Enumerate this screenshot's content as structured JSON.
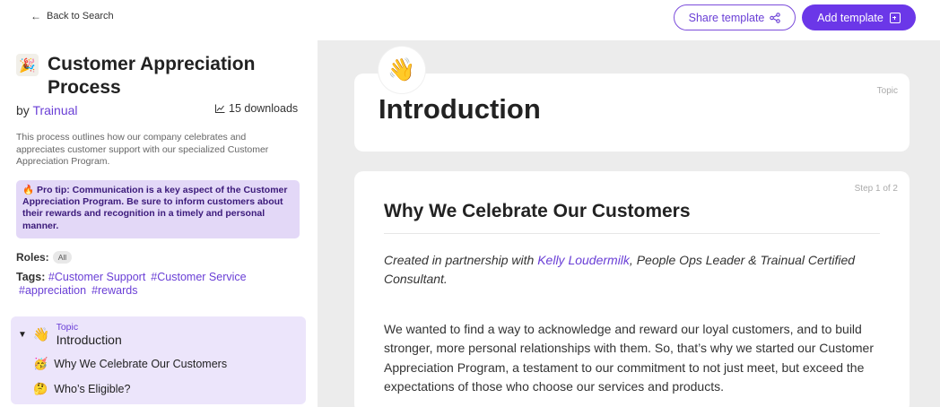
{
  "topbar": {
    "back_label": "Back to Search",
    "back_icon": "arrow-left-icon",
    "share_label": "Share template",
    "share_icon": "share-icon",
    "add_label": "Add template",
    "add_icon": "plus-square-icon",
    "accent": "#6b37e8"
  },
  "sidebar": {
    "title_emoji": "🎉",
    "title": "Customer Appreciation Process",
    "by_prefix": "by",
    "author": "Trainual",
    "downloads_icon": "chart-icon",
    "downloads": "15 downloads",
    "description": "This process outlines how our company celebrates and appreciates customer support with our specialized Customer Appreciation Program.",
    "protip": "🔥 Pro tip: Communication is a key aspect of the Customer Appreciation Program. Be sure to inform customers about their rewards and recognition in a timely and personal manner.",
    "roles_label": "Roles:",
    "roles_value": "All",
    "tags_label": "Tags:",
    "tags": [
      "#Customer Support",
      "#Customer Service",
      "#appreciation",
      "#rewards"
    ],
    "outline": {
      "type": "Topic",
      "emoji": "👋",
      "title": "Introduction",
      "items": [
        {
          "emoji": "🥳",
          "label": "Why We Celebrate Our Customers"
        },
        {
          "emoji": "🤔",
          "label": "Who’s Eligible?"
        }
      ]
    }
  },
  "main": {
    "topic": {
      "emoji": "👋",
      "label": "Topic",
      "title": "Introduction"
    },
    "step": {
      "label": "Step 1 of 2",
      "title": "Why We Celebrate Our Customers",
      "credit_prefix": "Created in partnership with ",
      "credit_person": "Kelly Loudermilk",
      "credit_suffix": ", People Ops Leader & Trainual Certified Consultant.",
      "body": "We wanted to find a way to acknowledge and reward our loyal customers, and to build stronger, more personal relationships with them. So, that’s why we started our Customer Appreciation Program, a testament to our commitment to not just meet, but exceed the expectations of those who choose our services and products."
    }
  }
}
